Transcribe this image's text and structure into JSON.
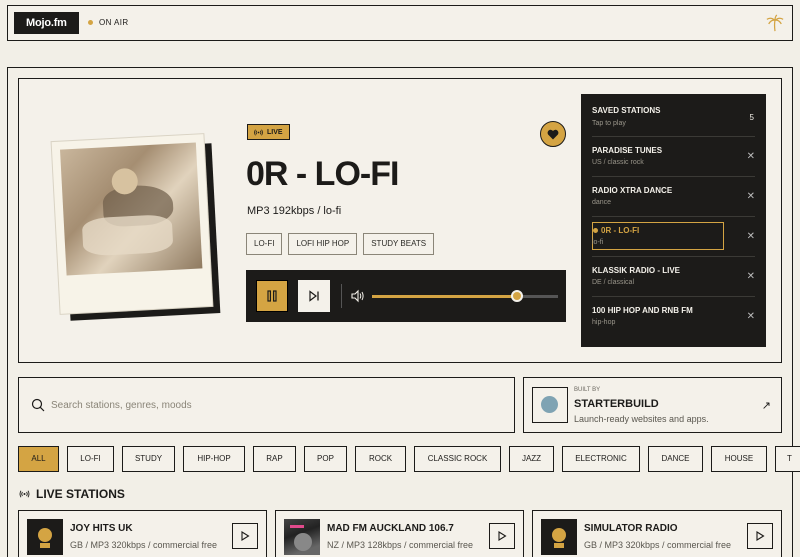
{
  "topbar": {
    "logo": "Mojo.fm",
    "status": "ON AIR"
  },
  "now_playing": {
    "live_label": "LIVE",
    "title": "0R - LO-FI",
    "meta": "MP3 192kbps / lo-fi",
    "tags": [
      "LO-FI",
      "LOFI HIP HOP",
      "STUDY BEATS"
    ],
    "volume": 0.78
  },
  "saved": {
    "title": "SAVED STATIONS",
    "subtitle": "Tap to play",
    "count": "5",
    "items": [
      {
        "name": "PARADISE TUNES",
        "sub": "US / classic rock",
        "active": false
      },
      {
        "name": "RADIO XTRA DANCE",
        "sub": "dance",
        "active": false
      },
      {
        "name": "0R - LO-FI",
        "sub": "lo-fi",
        "active": true
      },
      {
        "name": "KLASSIK RADIO - LIVE",
        "sub": "DE / classical",
        "active": false
      },
      {
        "name": "100 HIP HOP AND RNB FM",
        "sub": "hip-hop",
        "active": false
      }
    ]
  },
  "search": {
    "placeholder": "Search stations, genres, moods"
  },
  "builder": {
    "by": "BUILT BY",
    "name": "STARTERBUILD",
    "desc": "Launch-ready websites and apps."
  },
  "genres": [
    "ALL",
    "LO-FI",
    "STUDY",
    "HIP-HOP",
    "RAP",
    "POP",
    "ROCK",
    "CLASSIC ROCK",
    "JAZZ",
    "ELECTRONIC",
    "DANCE",
    "HOUSE",
    "T"
  ],
  "active_genre": "ALL",
  "live_section": {
    "title": "LIVE STATIONS"
  },
  "stations": [
    {
      "name": "JOY HITS UK",
      "desc": "GB / MP3 320kbps / commercial free",
      "art": "trophy"
    },
    {
      "name": "MAD FM AUCKLAND 106.7",
      "desc": "NZ / MP3 128kbps / commercial free",
      "art": "photo"
    },
    {
      "name": "SIMULATOR RADIO",
      "desc": "GB / MP3 320kbps / commercial free",
      "art": "trophy"
    }
  ],
  "colors": {
    "accent": "#d4a443",
    "ink": "#1c1b19",
    "paper": "#f2efe7"
  }
}
